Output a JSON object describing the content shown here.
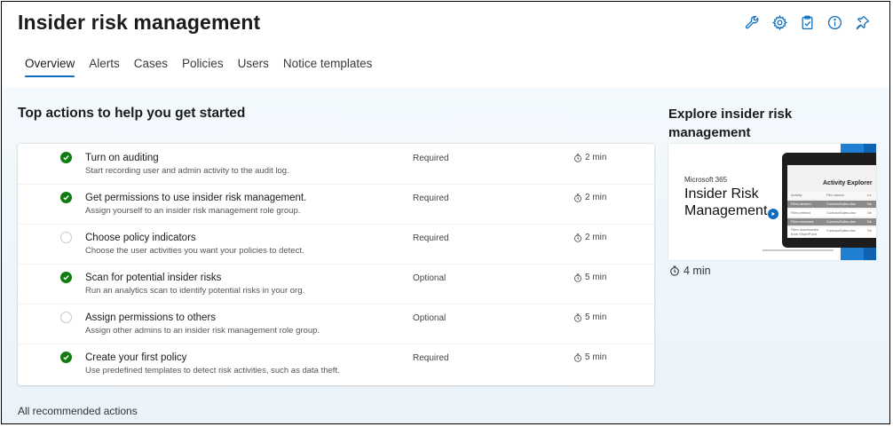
{
  "header": {
    "title": "Insider risk management",
    "icons": [
      "wrench-icon",
      "gear-icon",
      "clipboard-icon",
      "info-icon",
      "pin-icon"
    ]
  },
  "tabs": [
    {
      "label": "Overview",
      "active": true
    },
    {
      "label": "Alerts",
      "active": false
    },
    {
      "label": "Cases",
      "active": false
    },
    {
      "label": "Policies",
      "active": false
    },
    {
      "label": "Users",
      "active": false
    },
    {
      "label": "Notice templates",
      "active": false
    }
  ],
  "main": {
    "section_title": "Top actions to help you get started",
    "actions": [
      {
        "title": "Turn on auditing",
        "description": "Start recording user and admin activity to the audit log.",
        "requirement": "Required",
        "time": "2 min",
        "done": true
      },
      {
        "title": "Get permissions to use insider risk management.",
        "description": "Assign yourself to an insider risk management role group.",
        "requirement": "Required",
        "time": "2 min",
        "done": true
      },
      {
        "title": "Choose policy indicators",
        "description": "Choose the user activities you want your policies to detect.",
        "requirement": "Required",
        "time": "2 min",
        "done": false
      },
      {
        "title": "Scan for potential insider risks",
        "description": "Run an analytics scan to identify potential risks in your org.",
        "requirement": "Optional",
        "time": "5 min",
        "done": true
      },
      {
        "title": "Assign permissions to others",
        "description": "Assign other admins to an insider risk management role group.",
        "requirement": "Optional",
        "time": "5 min",
        "done": false
      },
      {
        "title": "Create your first policy",
        "description": "Use predefined templates to detect risk activities, such as data theft.",
        "requirement": "Required",
        "time": "5 min",
        "done": true
      }
    ],
    "all_actions_link": "All recommended actions"
  },
  "explore": {
    "title": "Explore insider risk management",
    "video": {
      "brand": "Microsoft 365",
      "headline_line1": "Insider Risk",
      "headline_line2": "Management",
      "screen_title": "Activity Explorer",
      "screen_rows": [
        {
          "activity": "Activity",
          "file": "File names",
          "col3": "Lo"
        },
        {
          "activity": "Files deleted",
          "file": "ContosoSales.xlsx",
          "col3": "De"
        },
        {
          "activity": "Files printed",
          "file": "ContosoSales.xlsx",
          "col3": "De"
        },
        {
          "activity": "Files renamed",
          "file": "ContosoSales.xlsx",
          "col3": "De"
        },
        {
          "activity": "Files downloaded from SharePoint",
          "file": "ContosoSales.xlsx",
          "col3": "Sh"
        }
      ]
    },
    "duration": "4 min"
  },
  "colors": {
    "accent": "#0f6cbd",
    "success": "#107c10",
    "brand_blue": "#1f7fd3"
  }
}
